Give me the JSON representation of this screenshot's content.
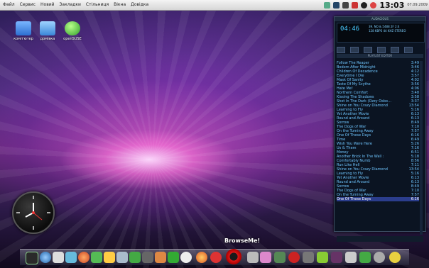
{
  "menu": [
    "Файл",
    "Сервис",
    "Новий",
    "Закладки",
    "Стільниця",
    "Вікна",
    "Довідка"
  ],
  "clock": "13:03",
  "date": "07.09.2009",
  "desktop_icons": [
    {
      "label": "комп'ютер"
    },
    {
      "label": "домівка"
    },
    {
      "label": "openSUSE"
    }
  ],
  "player": {
    "title": "AUDACIOUS",
    "time": "04:46",
    "info_line1": "39. NO & 5488 2F 2:4",
    "info_line2": "128 KBPS 44 KHZ STEREO",
    "playlist_title": "PLAYLIST EDITOR",
    "tracks": [
      {
        "title": "Follow The Reaper",
        "len": "3:49"
      },
      {
        "title": "Bodom After Midnight",
        "len": "3:46"
      },
      {
        "title": "Children Of Decadence",
        "len": "4:12"
      },
      {
        "title": "Everytime I Die",
        "len": "3:57"
      },
      {
        "title": "Mask Of Sanity",
        "len": "4:02"
      },
      {
        "title": "Taste Of My Scythe",
        "len": "3:56"
      },
      {
        "title": "Hate Me!",
        "len": "4:06"
      },
      {
        "title": "Northern Comfort",
        "len": "3:48"
      },
      {
        "title": "Kissing The Shadows",
        "len": "3:58"
      },
      {
        "title": "Shot In The Dark (Ozzy Osbo…",
        "len": "3:37"
      },
      {
        "title": "Shine on You Crazy Diamond",
        "len": "13:54"
      },
      {
        "title": "Learning to Fly",
        "len": "5:16"
      },
      {
        "title": "Yet Another Movie",
        "len": "6:13"
      },
      {
        "title": "Round and Around",
        "len": "6:13"
      },
      {
        "title": "Sorrow",
        "len": "8:49"
      },
      {
        "title": "The Dogs of War",
        "len": "7:10"
      },
      {
        "title": "On the Turning Away",
        "len": "7:57"
      },
      {
        "title": "One Of These Days",
        "len": "6:16"
      },
      {
        "title": "Time",
        "len": "6:49"
      },
      {
        "title": "Wish You Were Here",
        "len": "5:26"
      },
      {
        "title": "Us & Them",
        "len": "7:16"
      },
      {
        "title": "Money",
        "len": "6:51"
      },
      {
        "title": "Another Brick In The Wall :",
        "len": "5:18"
      },
      {
        "title": "Comfortably Numb",
        "len": "8:56"
      },
      {
        "title": "Run Like Hell",
        "len": "7:11"
      },
      {
        "title": "Shine on You Crazy Diamond",
        "len": "13:54"
      },
      {
        "title": "Learning to Fly",
        "len": "5:16"
      },
      {
        "title": "Yet Another Movie",
        "len": "6:13"
      },
      {
        "title": "Round and Around",
        "len": "6:13"
      },
      {
        "title": "Sorrow",
        "len": "8:49"
      },
      {
        "title": "The Dogs of War",
        "len": "7:10"
      },
      {
        "title": "On the Turning Away",
        "len": "7:57"
      },
      {
        "title": "One Of These Days",
        "len": "6:16"
      }
    ],
    "selected_index": 32
  },
  "dock_label": "BrowseMe!",
  "colors": {
    "accent": "#49c9ff",
    "selection": "#2b3d8c",
    "opera": "#d01818"
  }
}
